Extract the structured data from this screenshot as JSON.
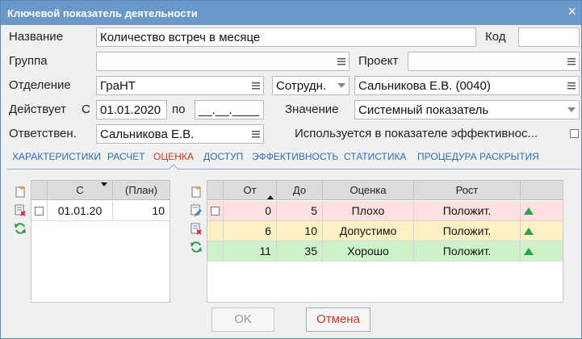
{
  "window": {
    "title": "Ключевой показатель деятельности",
    "close": "×"
  },
  "form": {
    "name_label": "Название",
    "name_value": "Количество встреч в месяце",
    "code_label": "Код",
    "code_value": "",
    "group_label": "Группа",
    "group_value": "",
    "project_label": "Проект",
    "project_value": "",
    "dept_label": "Отделение",
    "dept_value": "ГраНТ",
    "employee_select": "Сотрудн.",
    "employee_value": "Сальникова Е.В. (0040)",
    "active_label": "Действует",
    "active_from_label": "С",
    "active_from": "01.01.2020",
    "active_to_label": "по",
    "active_to": "__.__.____",
    "value_label": "Значение",
    "value_value": "Системный показатель",
    "resp_label": "Ответствен.",
    "resp_value": "Сальникова Е.В.",
    "used_label": "Используется в показателе эффективнос..."
  },
  "tabs": [
    {
      "label": "ХАРАКТЕРИСТИКИ"
    },
    {
      "label": "РАСЧЕТ"
    },
    {
      "label": "ОЦЕНКА"
    },
    {
      "label": "ДОСТУП"
    },
    {
      "label": "ЭФФЕКТИВНОСТЬ"
    },
    {
      "label": "СТАТИСТИКА"
    },
    {
      "label": "ПРОЦЕДУРА РАСКРЫТИЯ"
    }
  ],
  "left_grid": {
    "headers": {
      "from": "С",
      "plan": "(План)"
    },
    "rows": [
      {
        "from": "01.01.20",
        "plan": "10"
      }
    ]
  },
  "right_grid": {
    "headers": {
      "from": "От",
      "to": "До",
      "grade": "Оценка",
      "growth": "Рост"
    },
    "rows": [
      {
        "from": "0",
        "to": "5",
        "grade": "Плохо",
        "growth": "Положит.",
        "color": "#fde0e0"
      },
      {
        "from": "6",
        "to": "10",
        "grade": "Допустимо",
        "growth": "Положит.",
        "color": "#fdf0c4"
      },
      {
        "from": "11",
        "to": "35",
        "grade": "Хорошо",
        "growth": "Положит.",
        "color": "#cdf2c8"
      }
    ]
  },
  "buttons": {
    "ok": "OK",
    "cancel": "Отмена"
  },
  "colors": {
    "titlebar": "#6a99c9",
    "tab": "#2a6fb6",
    "tab_active": "#c0392b",
    "cancel_border": "#c0392b",
    "arrow_up": "#2e9e4e"
  }
}
